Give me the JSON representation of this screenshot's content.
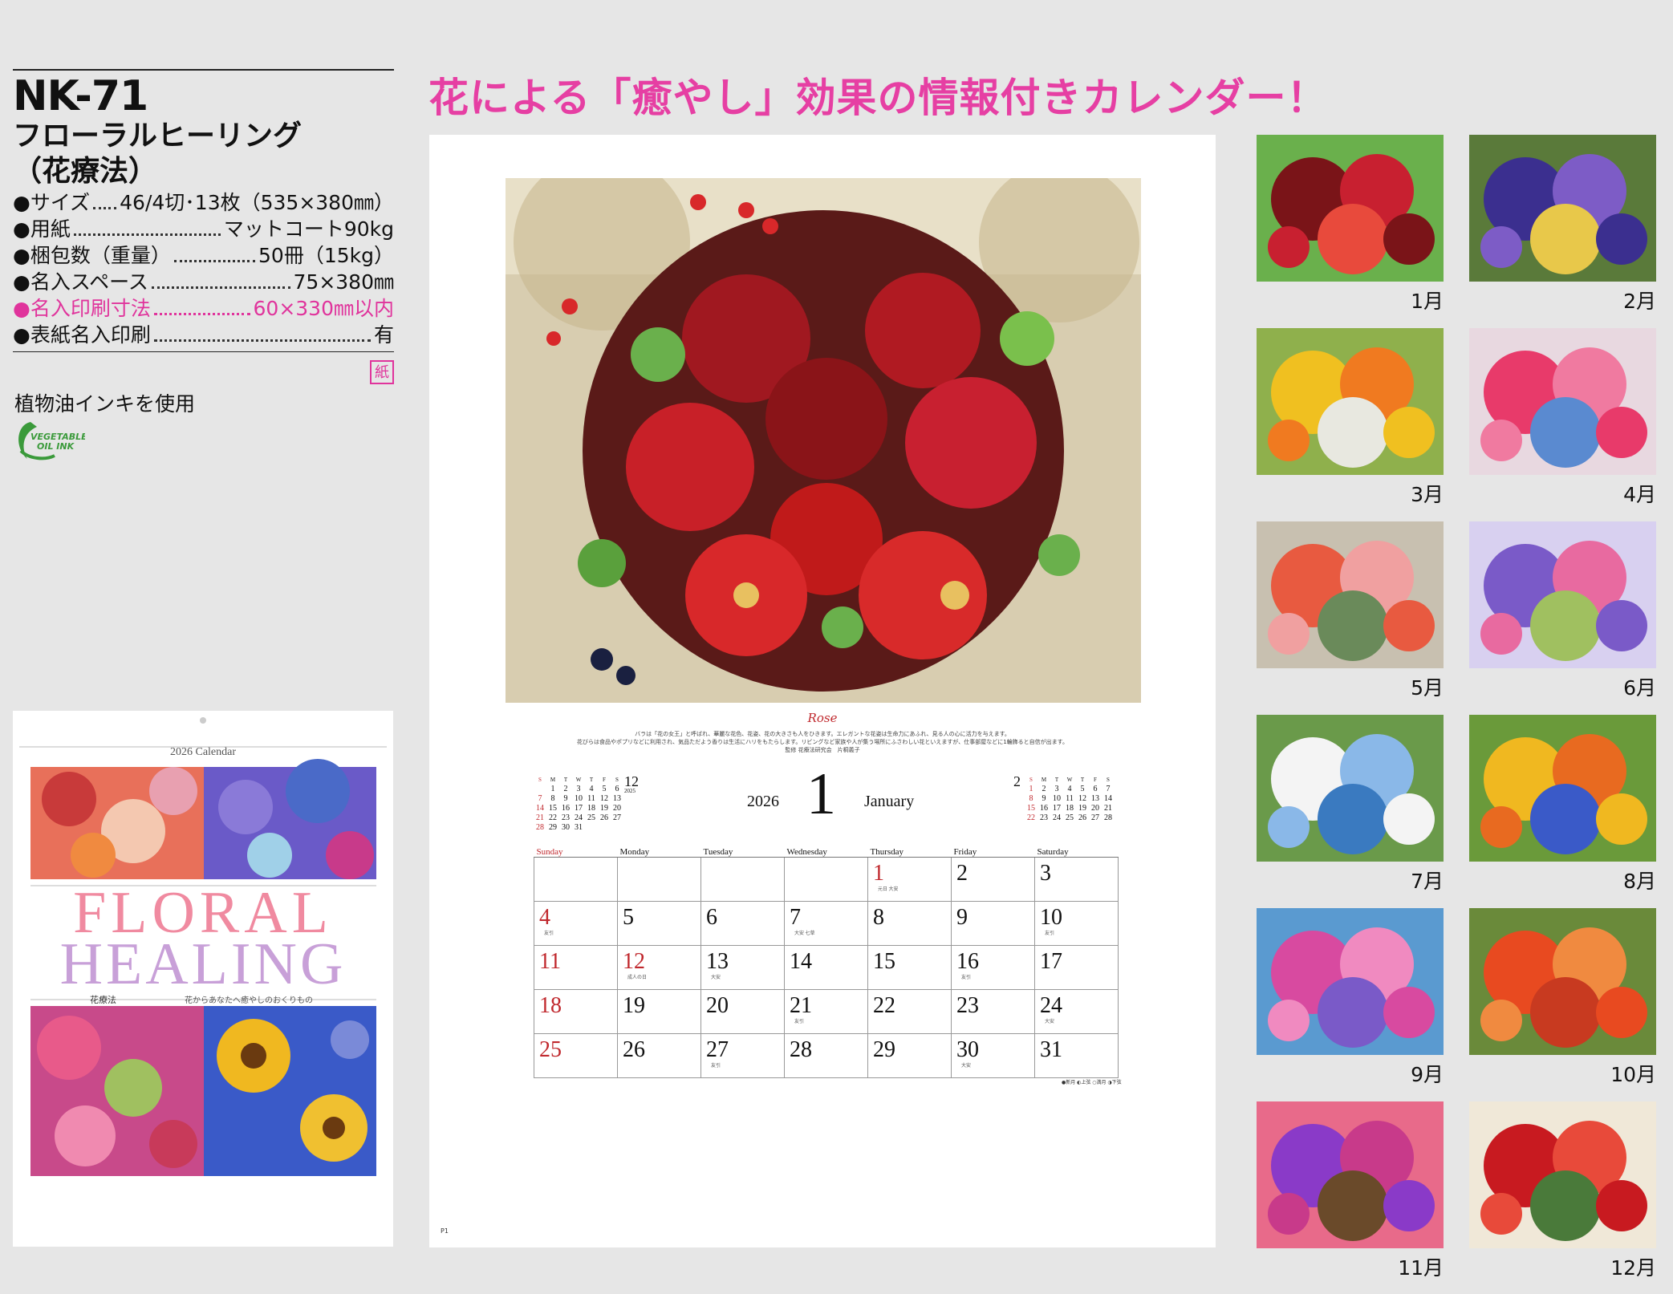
{
  "product": {
    "model": "NK-71",
    "name_line1": "フローラルヒーリング",
    "name_line2": "（花療法）"
  },
  "specs": [
    {
      "label": "●サイズ",
      "value": "46/4切･13枚（535×380㎜）",
      "highlight": false
    },
    {
      "label": "●用紙",
      "value": "マットコート90kg",
      "highlight": false
    },
    {
      "label": "●梱包数（重量）",
      "value": "50冊（15kg）",
      "highlight": false
    },
    {
      "label": "●名入スペース",
      "value": "75×380㎜",
      "highlight": false
    },
    {
      "label": "●名入印刷寸法",
      "value": "60×330㎜以内",
      "highlight": true
    },
    {
      "label": "●表紙名入印刷",
      "value": "有",
      "highlight": false
    }
  ],
  "paper_badge": "紙",
  "ink_text": "植物油インキを使用",
  "ink_logo": {
    "line1": "VEGETABLE",
    "line2": "OIL INK"
  },
  "cover": {
    "calendar_label": "2026 Calendar",
    "title_line1": "FLORAL",
    "title_line2": "HEALING",
    "subtitle_jp": "花療法",
    "subtitle_tagline": "花からあなたへ癒やしのおくりもの"
  },
  "headline": "花による「癒やし」効果の情報付きカレンダー！",
  "sheet": {
    "flower_name": "Rose",
    "caption_line1": "バラは「花の女王」と呼ばれ、華麗な花色、花姿、花の大きさも人をひきます。エレガントな花姿は生命力にあふれ、見る人の心に活力を与えます。",
    "caption_line2": "花びらは食品やポプリなどに利用され、気品ただよう香りは生活にハリをもたらします。リビングなど家族や人が集う場所にふさわしい花といえますが、仕事部屋などに1輪飾ると自信が出ます。",
    "caption_credit": "監修 花療法研究会　片桐義子",
    "year": "2026",
    "month_number": "1",
    "month_name": "January",
    "page_label": "P1",
    "moon_legend": "●新月 ◐上弦 ○満月 ◑下弦"
  },
  "prev_month": {
    "number": "12",
    "year": "2025",
    "weekdays": [
      "S",
      "M",
      "T",
      "W",
      "T",
      "F",
      "S"
    ],
    "weeks": [
      [
        "",
        "1",
        "2",
        "3",
        "4",
        "5",
        "6"
      ],
      [
        "7",
        "8",
        "9",
        "10",
        "11",
        "12",
        "13"
      ],
      [
        "14",
        "15",
        "16",
        "17",
        "18",
        "19",
        "20"
      ],
      [
        "21",
        "22",
        "23",
        "24",
        "25",
        "26",
        "27"
      ],
      [
        "28",
        "29",
        "30",
        "31",
        "",
        "",
        ""
      ]
    ]
  },
  "next_month": {
    "number": "2",
    "weekdays": [
      "S",
      "M",
      "T",
      "W",
      "T",
      "F",
      "S"
    ],
    "weeks": [
      [
        "1",
        "2",
        "3",
        "4",
        "5",
        "6",
        "7"
      ],
      [
        "8",
        "9",
        "10",
        "11",
        "12",
        "13",
        "14"
      ],
      [
        "15",
        "16",
        "17",
        "18",
        "19",
        "20",
        "21"
      ],
      [
        "22",
        "23",
        "24",
        "25",
        "26",
        "27",
        "28"
      ]
    ]
  },
  "weekday_headers": [
    "Sunday",
    "Monday",
    "Tuesday",
    "Wednesday",
    "Thursday",
    "Friday",
    "Saturday"
  ],
  "calendar_weeks": [
    [
      {
        "d": ""
      },
      {
        "d": ""
      },
      {
        "d": ""
      },
      {
        "d": ""
      },
      {
        "d": "1",
        "n": "元日 大安",
        "red": true
      },
      {
        "d": "2"
      },
      {
        "d": "3"
      }
    ],
    [
      {
        "d": "4",
        "n": "友引",
        "red": true
      },
      {
        "d": "5"
      },
      {
        "d": "6"
      },
      {
        "d": "7",
        "n": "大安 七草"
      },
      {
        "d": "8"
      },
      {
        "d": "9"
      },
      {
        "d": "10",
        "n": "友引"
      }
    ],
    [
      {
        "d": "11",
        "red": true
      },
      {
        "d": "12",
        "n": "成人の日",
        "red": true
      },
      {
        "d": "13",
        "n": "大安"
      },
      {
        "d": "14"
      },
      {
        "d": "15"
      },
      {
        "d": "16",
        "n": "友引"
      },
      {
        "d": "17"
      }
    ],
    [
      {
        "d": "18",
        "red": true
      },
      {
        "d": "19"
      },
      {
        "d": "20"
      },
      {
        "d": "21",
        "n": "友引"
      },
      {
        "d": "22"
      },
      {
        "d": "23"
      },
      {
        "d": "24",
        "n": "大安"
      }
    ],
    [
      {
        "d": "25",
        "red": true
      },
      {
        "d": "26"
      },
      {
        "d": "27",
        "n": "友引"
      },
      {
        "d": "28"
      },
      {
        "d": "29"
      },
      {
        "d": "30",
        "n": "大安"
      },
      {
        "d": "31"
      }
    ]
  ],
  "months": [
    {
      "label": "1月",
      "palette": [
        "#7a1418",
        "#c82030",
        "#e84a3c",
        "#6ab04c"
      ]
    },
    {
      "label": "2月",
      "palette": [
        "#3b2f8f",
        "#7d5cc6",
        "#e8c84a",
        "#5a7a3a"
      ]
    },
    {
      "label": "3月",
      "palette": [
        "#f0c020",
        "#f07a20",
        "#e8e8e0",
        "#8fb04c"
      ]
    },
    {
      "label": "4月",
      "palette": [
        "#e83a6a",
        "#f07aa0",
        "#5a8ad0",
        "#e8d8e0"
      ]
    },
    {
      "label": "5月",
      "palette": [
        "#e85a40",
        "#f0a0a0",
        "#6a8a5a",
        "#c8c0b0"
      ]
    },
    {
      "label": "6月",
      "palette": [
        "#7a5ac8",
        "#e86aa0",
        "#a0c060",
        "#d8d0f0"
      ]
    },
    {
      "label": "7月",
      "palette": [
        "#f4f4f4",
        "#8ab8e8",
        "#3a7ac0",
        "#6a9a4a"
      ]
    },
    {
      "label": "8月",
      "palette": [
        "#f0b820",
        "#e86a20",
        "#3a5ac8",
        "#6a9a3a"
      ]
    },
    {
      "label": "9月",
      "palette": [
        "#d84aa0",
        "#f08ac0",
        "#7a5ac8",
        "#5a9ad0"
      ]
    },
    {
      "label": "10月",
      "palette": [
        "#e84a20",
        "#f08a40",
        "#c83a20",
        "#6a8a3a"
      ]
    },
    {
      "label": "11月",
      "palette": [
        "#8a3ac8",
        "#c83a8a",
        "#6a4a2a",
        "#e86a8a"
      ]
    },
    {
      "label": "12月",
      "palette": [
        "#c81a20",
        "#e84a3a",
        "#4a7a3a",
        "#f0e8d8"
      ]
    }
  ]
}
